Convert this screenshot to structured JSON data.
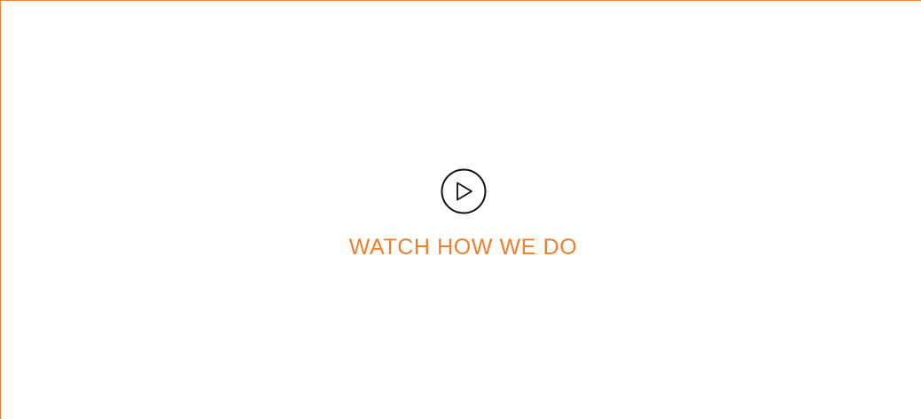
{
  "video_section": {
    "play_icon": "play-circle-icon",
    "label": "WATCH HOW WE DO",
    "accent_color": "#ee7f2d",
    "icon_color": "#111111"
  }
}
